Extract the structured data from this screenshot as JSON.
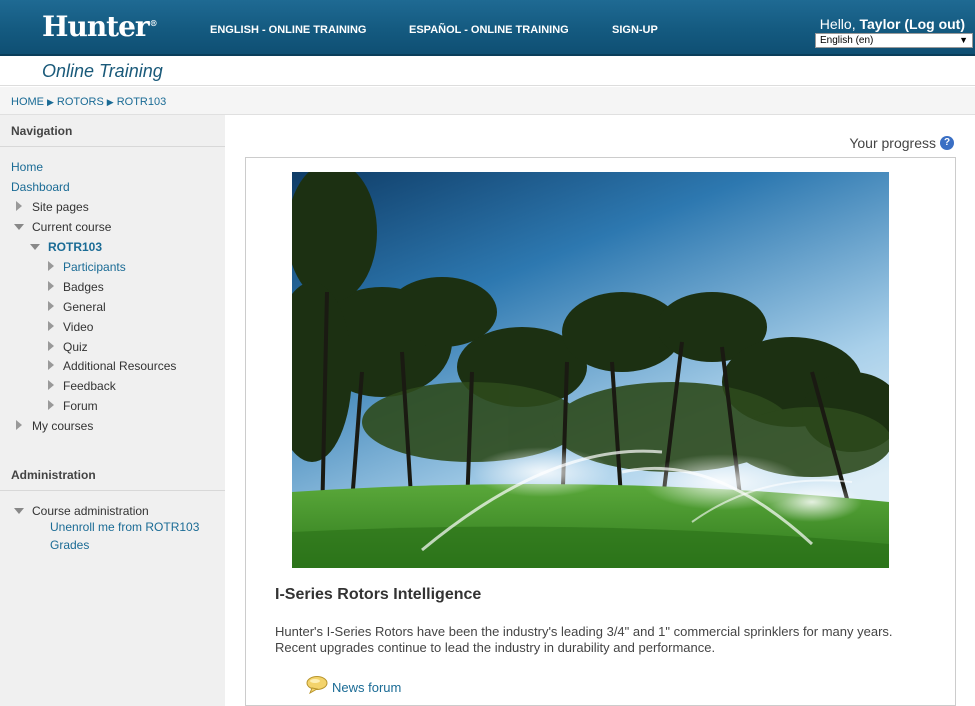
{
  "header": {
    "logo": "Hunter",
    "logo_mark": "®",
    "nav": [
      {
        "label": "ENGLISH - ONLINE TRAINING"
      },
      {
        "label": "ESPAÑOL - ONLINE TRAINING"
      },
      {
        "label": "SIGN-UP"
      }
    ],
    "hello": "Hello,",
    "user": "Taylor",
    "logout": "(Log out)",
    "language": "English (en)"
  },
  "site_title": "Online Training",
  "breadcrumb": [
    "HOME",
    "ROTORS",
    "ROTR103"
  ],
  "sidebar": {
    "navigation_title": "Navigation",
    "home": "Home",
    "dashboard": "Dashboard",
    "site_pages": "Site pages",
    "current_course": "Current course",
    "course": "ROTR103",
    "course_items": [
      "Participants",
      "Badges",
      "General",
      "Video",
      "Quiz",
      "Additional Resources",
      "Feedback",
      "Forum"
    ],
    "my_courses": "My courses",
    "administration_title": "Administration",
    "course_administration": "Course administration",
    "unenroll": "Unenroll me from ROTR103",
    "grades": "Grades"
  },
  "main": {
    "progress_label": "Your progress",
    "help": "?",
    "section_title": "I-Series Rotors Intelligence",
    "summary": "Hunter's I-Series Rotors have been the industry's leading 3/4\" and 1\" commercial sprinklers for many years.  Recent upgrades continue to lead the industry in durability and performance.",
    "forum_link": "News forum"
  },
  "colors": {
    "header_blue": "#145a80",
    "link": "#1a6b95",
    "grass": "#4e9a2e",
    "sky": "#1a5f8f"
  }
}
